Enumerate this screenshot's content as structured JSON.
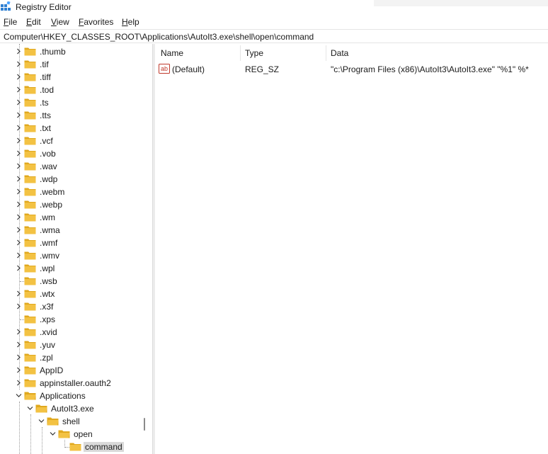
{
  "window": {
    "title": "Registry Editor"
  },
  "menu": [
    {
      "key": "F",
      "rest": "ile"
    },
    {
      "key": "E",
      "rest": "dit"
    },
    {
      "key": "V",
      "rest": "iew"
    },
    {
      "key": "F",
      "rest": "avorites",
      "pre": ""
    },
    {
      "key": "H",
      "rest": "elp"
    }
  ],
  "address": "Computer\\HKEY_CLASSES_ROOT\\Applications\\AutoIt3.exe\\shell\\open\\command",
  "tree": [
    {
      "label": ".thumb",
      "expander": "collapsed"
    },
    {
      "label": ".tif",
      "expander": "collapsed"
    },
    {
      "label": ".tiff",
      "expander": "collapsed"
    },
    {
      "label": ".tod",
      "expander": "collapsed"
    },
    {
      "label": ".ts",
      "expander": "collapsed"
    },
    {
      "label": ".tts",
      "expander": "collapsed"
    },
    {
      "label": ".txt",
      "expander": "collapsed"
    },
    {
      "label": ".vcf",
      "expander": "collapsed"
    },
    {
      "label": ".vob",
      "expander": "collapsed"
    },
    {
      "label": ".wav",
      "expander": "collapsed"
    },
    {
      "label": ".wdp",
      "expander": "collapsed"
    },
    {
      "label": ".webm",
      "expander": "collapsed"
    },
    {
      "label": ".webp",
      "expander": "collapsed"
    },
    {
      "label": ".wm",
      "expander": "collapsed"
    },
    {
      "label": ".wma",
      "expander": "collapsed"
    },
    {
      "label": ".wmf",
      "expander": "collapsed"
    },
    {
      "label": ".wmv",
      "expander": "collapsed"
    },
    {
      "label": ".wpl",
      "expander": "collapsed"
    },
    {
      "label": ".wsb",
      "expander": "none"
    },
    {
      "label": ".wtx",
      "expander": "collapsed"
    },
    {
      "label": ".x3f",
      "expander": "collapsed"
    },
    {
      "label": ".xps",
      "expander": "none"
    },
    {
      "label": ".xvid",
      "expander": "collapsed"
    },
    {
      "label": ".yuv",
      "expander": "collapsed"
    },
    {
      "label": ".zpl",
      "expander": "collapsed"
    },
    {
      "label": "AppID",
      "expander": "collapsed"
    },
    {
      "label": "appinstaller.oauth2",
      "expander": "collapsed"
    },
    {
      "label": "Applications",
      "expander": "expanded"
    },
    {
      "label": "AutoIt3.exe",
      "expander": "expanded"
    },
    {
      "label": "shell",
      "expander": "expanded"
    },
    {
      "label": "open",
      "expander": "expanded"
    },
    {
      "label": "command",
      "expander": "none",
      "selected": true
    }
  ],
  "list": {
    "columns": [
      "Name",
      "Type",
      "Data"
    ],
    "rows": [
      {
        "name": "(Default)",
        "type": "REG_SZ",
        "data": "\"c:\\Program Files (x86)\\AutoIt3\\AutoIt3.exe\" \"%1\" %*",
        "icon": "string-value-icon"
      }
    ]
  },
  "colors": {
    "folder": "#f3c243",
    "folder_dark": "#e0a81e",
    "selection": "#d9d9d9"
  }
}
